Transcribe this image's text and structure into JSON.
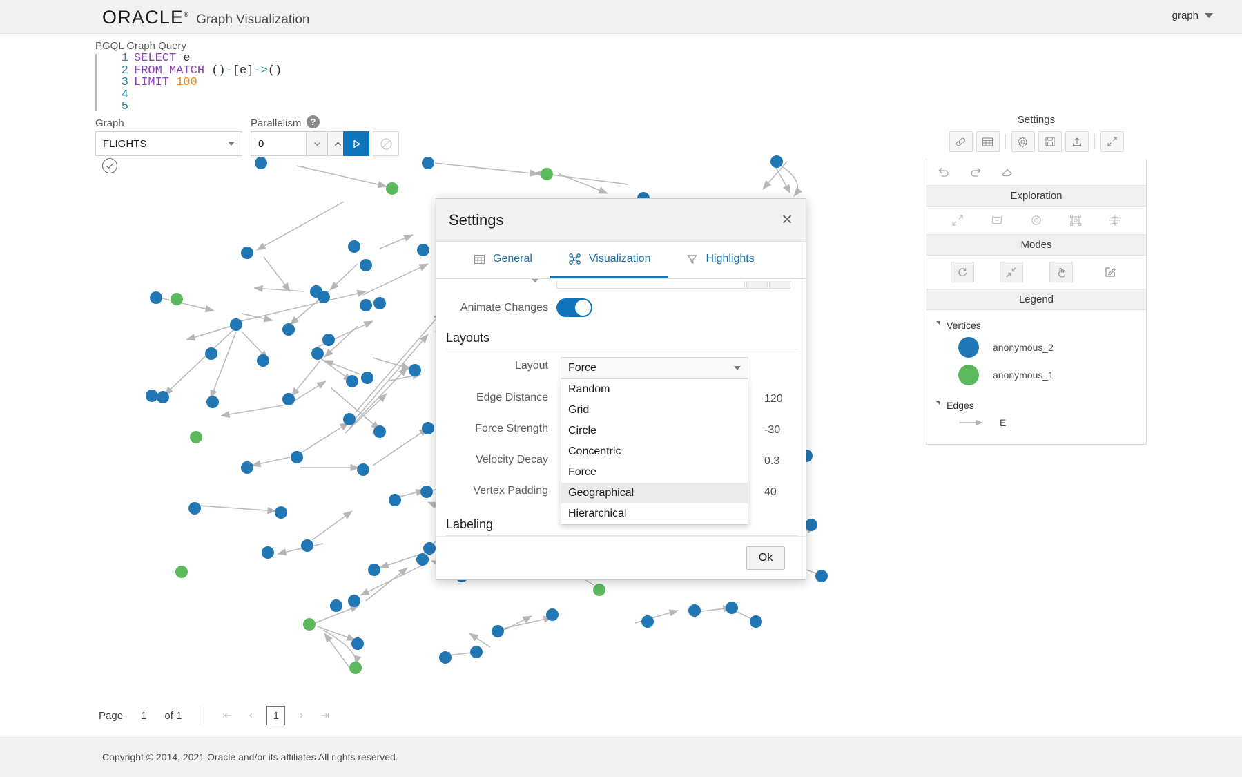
{
  "header": {
    "logo": "ORACLE",
    "app_title": "Graph Visualization",
    "user_menu": "graph"
  },
  "query": {
    "label": "PGQL Graph Query",
    "lines": [
      {
        "n": "1",
        "tokens": [
          {
            "t": "SELECT",
            "c": "kw"
          },
          {
            "t": " e",
            "c": "pl"
          }
        ]
      },
      {
        "n": "2",
        "tokens": [
          {
            "t": "FROM MATCH",
            "c": "kw"
          },
          {
            "t": " ()",
            "c": "pl"
          },
          {
            "t": "-",
            "c": "op"
          },
          {
            "t": "[e]",
            "c": "pl"
          },
          {
            "t": "->",
            "c": "op"
          },
          {
            "t": "()",
            "c": "pl"
          }
        ]
      },
      {
        "n": "3",
        "tokens": [
          {
            "t": "LIMIT",
            "c": "kw"
          },
          {
            "t": " ",
            "c": "pl"
          },
          {
            "t": "100",
            "c": "num"
          }
        ]
      },
      {
        "n": "4",
        "tokens": []
      },
      {
        "n": "5",
        "tokens": []
      }
    ]
  },
  "controls": {
    "graph_label": "Graph",
    "graph_value": "FLIGHTS",
    "parallelism_label": "Parallelism",
    "parallelism_help": "?",
    "parallelism_value": "0",
    "run_icon": "play-icon",
    "stop_icon": "cancel-icon",
    "status_icon": "check-circle-icon"
  },
  "right_panel": {
    "settings_title": "Settings",
    "toolbar": [
      {
        "name": "link-button",
        "icon": "link-icon"
      },
      {
        "name": "table-button",
        "icon": "table-icon"
      },
      {
        "name": "gear-button",
        "icon": "gear-icon"
      },
      {
        "name": "save-button",
        "icon": "save-icon"
      },
      {
        "name": "upload-button",
        "icon": "upload-icon"
      },
      {
        "name": "expand-button",
        "icon": "expand-icon"
      }
    ],
    "history": [
      {
        "name": "undo-button",
        "icon": "undo-icon"
      },
      {
        "name": "redo-button",
        "icon": "redo-icon"
      },
      {
        "name": "erase-button",
        "icon": "eraser-icon"
      }
    ],
    "exploration_label": "Exploration",
    "exploration_icons": [
      {
        "name": "expand-graph-button",
        "icon": "diagonal-arrows-icon"
      },
      {
        "name": "collapse-button",
        "icon": "minus-box-icon"
      },
      {
        "name": "focus-button",
        "icon": "target-icon"
      },
      {
        "name": "group-button",
        "icon": "frame-icon"
      },
      {
        "name": "ungroup-button",
        "icon": "ungroup-icon"
      }
    ],
    "modes_label": "Modes",
    "modes_icons": [
      {
        "name": "rotate-mode-button",
        "icon": "rotate-icon",
        "active": true
      },
      {
        "name": "shrink-mode-button",
        "icon": "shrink-arrows-icon",
        "active": true
      },
      {
        "name": "pick-mode-button",
        "icon": "hand-pointer-icon",
        "active": true
      },
      {
        "name": "edit-mode-button",
        "icon": "pencil-square-icon",
        "active": false
      }
    ],
    "legend_label": "Legend",
    "vertices_group": "Vertices",
    "vertices": [
      {
        "label": "anonymous_2",
        "color": "#2177b4"
      },
      {
        "label": "anonymous_1",
        "color": "#5cb85c"
      }
    ],
    "edges_group": "Edges",
    "edges": [
      {
        "label": "E",
        "color": "#b3b3b3"
      }
    ]
  },
  "pagination": {
    "page_label": "Page",
    "page_number": "1",
    "of_label": "of 1",
    "first_icon": "first-page-icon",
    "prev_icon": "prev-page-icon",
    "current": "1",
    "next_icon": "next-page-icon",
    "last_icon": "last-page-icon"
  },
  "footer": {
    "copyright": "Copyright © 2014, 2021 Oracle and/or its affiliates All rights reserved."
  },
  "dialog": {
    "title": "Settings",
    "close_icon": "close-icon",
    "tabs": [
      {
        "label": "General",
        "icon": "table-icon",
        "active": false
      },
      {
        "label": "Visualization",
        "icon": "graph-nodes-icon",
        "active": true
      },
      {
        "label": "Highlights",
        "icon": "funnel-icon",
        "active": false
      }
    ],
    "animate_changes_label": "Animate Changes",
    "animate_changes_on": true,
    "layouts_section": "Layouts",
    "labeling_section": "Labeling",
    "layout_label": "Layout",
    "layout_value": "Force",
    "layout_options": [
      {
        "label": "Random",
        "highlighted": false
      },
      {
        "label": "Grid",
        "highlighted": false
      },
      {
        "label": "Circle",
        "highlighted": false
      },
      {
        "label": "Concentric",
        "highlighted": false
      },
      {
        "label": "Force",
        "highlighted": false
      },
      {
        "label": "Geographical",
        "highlighted": true
      },
      {
        "label": "Hierarchical",
        "highlighted": false
      }
    ],
    "fields": [
      {
        "label": "Edge Distance",
        "value": "120"
      },
      {
        "label": "Force Strength",
        "value": "-30"
      },
      {
        "label": "Velocity Decay",
        "value": "0.3"
      },
      {
        "label": "Vertex Padding",
        "value": "40"
      }
    ],
    "ok_label": "Ok"
  },
  "colors": {
    "accent": "#1175bd",
    "vertex_blue": "#2177b4",
    "vertex_green": "#5cb85c",
    "edge_gray": "#b3b3b3"
  }
}
